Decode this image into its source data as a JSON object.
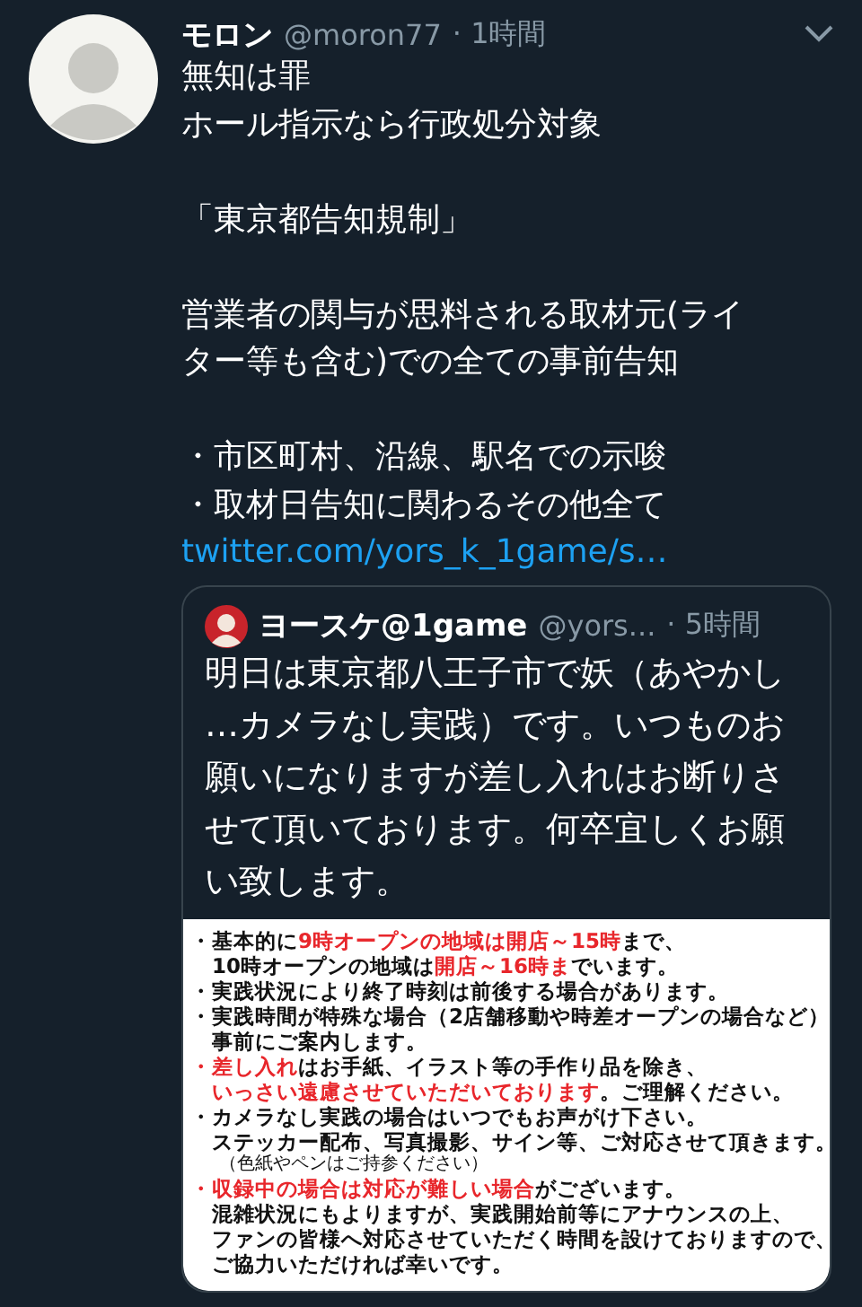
{
  "tweet": {
    "name": "モロン",
    "handle": "@moron77",
    "time": "· 1時間",
    "paragraphs": [
      {
        "lines": [
          "無知は罪",
          "ホール指示なら行政処分対象"
        ]
      },
      {
        "lines": [
          "「東京都告知規制」"
        ]
      },
      {
        "lines": [
          "営業者の関与が思料される取材元(ライ",
          "ター等も含む)での全ての事前告知"
        ]
      },
      {
        "lines": [
          "・市区町村、沿線、駅名での示唆",
          "・取材日告知に関わるその他全て"
        ]
      }
    ],
    "link": "twitter.com/yors_k_1game/s…",
    "quote": {
      "name": "ヨースケ@1game",
      "handle": "@yors...",
      "time": "· 5時間",
      "text_lines": [
        "明日は東京都八王子市で妖（あやかし",
        "…カメラなし実践）です。いつものお",
        "願いになりますが差し入れはお断りさ",
        "せて頂いております。何卒宜しくお願",
        "い致します。"
      ],
      "document": [
        {
          "kind": "bullet",
          "segments": [
            {
              "text": "・基本的に",
              "highlight": false
            },
            {
              "text": "9時オープンの地域は開店～15時",
              "highlight": true
            },
            {
              "text": "まで、",
              "highlight": false
            }
          ]
        },
        {
          "kind": "continuation",
          "segments": [
            {
              "text": "10時オープンの地域は",
              "highlight": false
            },
            {
              "text": "開店～16時ま",
              "highlight": true
            },
            {
              "text": "でいます。",
              "highlight": false
            }
          ]
        },
        {
          "kind": "bullet",
          "segments": [
            {
              "text": "・実践状況により終了時刻は前後する場合があります。",
              "highlight": false
            }
          ]
        },
        {
          "kind": "bullet",
          "segments": [
            {
              "text": "・実践時間が特殊な場合（2店舗移動や時差オープンの場合など）",
              "highlight": false
            }
          ]
        },
        {
          "kind": "continuation",
          "segments": [
            {
              "text": "事前にご案内します。",
              "highlight": false
            }
          ]
        },
        {
          "kind": "bullet",
          "segments": [
            {
              "text": "・差し入れ",
              "highlight": true
            },
            {
              "text": "はお手紙、イラスト等の手作り品を除き、",
              "highlight": false
            }
          ]
        },
        {
          "kind": "continuation",
          "segments": [
            {
              "text": "いっさい遠慮させていただいております",
              "highlight": true
            },
            {
              "text": "。ご理解ください。",
              "highlight": false
            }
          ]
        },
        {
          "kind": "bullet",
          "segments": [
            {
              "text": "・カメラなし実践の場合はいつでもお声がけ下さい。",
              "highlight": false
            }
          ]
        },
        {
          "kind": "continuation",
          "segments": [
            {
              "text": "ステッカー配布、写真撮影、サイン等、ご対応させて頂きます。",
              "highlight": false
            }
          ]
        },
        {
          "kind": "note",
          "segments": [
            {
              "text": "（色紙やペンはご持参ください）",
              "highlight": false
            }
          ]
        },
        {
          "kind": "bullet",
          "segments": [
            {
              "text": "・収録中の場合は対応が難しい場合",
              "highlight": true
            },
            {
              "text": "がございます。",
              "highlight": false
            }
          ]
        },
        {
          "kind": "continuation",
          "segments": [
            {
              "text": "混雑状況にもよりますが、実践開始前等にアナウンスの上、",
              "highlight": false
            }
          ]
        },
        {
          "kind": "continuation",
          "segments": [
            {
              "text": "ファンの皆様へ対応させていただく時間を設けておりますので、",
              "highlight": false
            }
          ]
        },
        {
          "kind": "continuation",
          "segments": [
            {
              "text": "ご協力いただければ幸いです。",
              "highlight": false
            }
          ]
        }
      ]
    }
  }
}
